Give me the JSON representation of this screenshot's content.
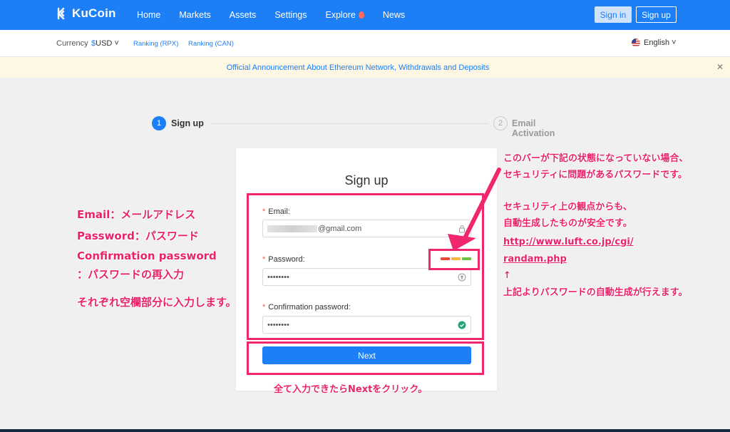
{
  "header": {
    "brand": "KuCoin",
    "nav": [
      {
        "label": "Home"
      },
      {
        "label": "Markets"
      },
      {
        "label": "Assets"
      },
      {
        "label": "Settings"
      },
      {
        "label": "Explore"
      },
      {
        "label": "News"
      }
    ],
    "signin_label": "Sign in",
    "signup_label": "Sign up",
    "brand_color": "#1d7ff5"
  },
  "subbar": {
    "currency_label": "Currency",
    "currency_symbol": "$",
    "currency_value": "USD",
    "ranking_rpx": "Ranking (RPX)",
    "ranking_can": "Ranking (CAN)",
    "language": "English"
  },
  "announcement": {
    "text": "Official Announcement About Ethereum Network, Withdrawals and Deposits",
    "close_icon": "close-icon"
  },
  "steps": [
    {
      "number": "1",
      "label": "Sign up",
      "active": true
    },
    {
      "number": "2",
      "label": "Email Activation",
      "active": false
    }
  ],
  "form": {
    "title": "Sign up",
    "email_label": "Email:",
    "email_value": "@gmail.com",
    "password_label": "Password:",
    "password_value": "••••••••",
    "password_strength_colors": [
      "#e84b3c",
      "#f5b93b",
      "#6cc24a"
    ],
    "confirm_label": "Confirmation password:",
    "confirm_value": "••••••••",
    "next_label": "Next"
  },
  "annotations": {
    "left": [
      "Email：メールアドレス",
      "Password：パスワード",
      "Confirmation password",
      "：パスワードの再入力",
      "それぞれ空欄部分に入力します。"
    ],
    "right": [
      "このバーが下記の状態になっていない場合、",
      "セキュリティに問題があるパスワードです。",
      "",
      "セキュリティ上の観点からも、",
      "自動生成したものが安全です。",
      "http://www.luft.co.jp/cgi/",
      "randam.php",
      "↑",
      "上記よりパスワードの自動生成が行えます。"
    ],
    "bottom": "全て入力できたらNextをクリック。",
    "highlight_color": "#f0276e"
  }
}
